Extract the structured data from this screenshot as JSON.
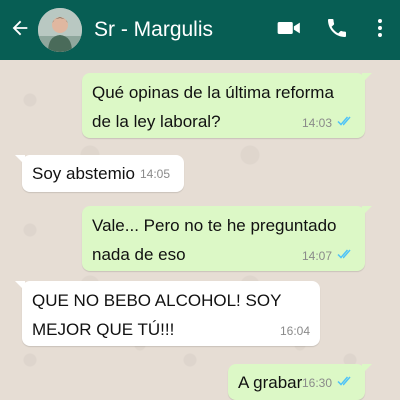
{
  "header": {
    "contact_name": "Sr - Margulis",
    "back_icon": "arrow-left-icon",
    "video_icon": "video-camera-icon",
    "call_icon": "phone-icon",
    "menu_icon": "more-vertical-icon",
    "bg_color": "#075e54"
  },
  "messages": [
    {
      "direction": "out",
      "text": "Qué opinas de la última reforma de la ley laboral?",
      "time": "14:03",
      "status": "read"
    },
    {
      "direction": "in",
      "text": "Soy abstemio",
      "time": "14:05"
    },
    {
      "direction": "out",
      "text": "Vale... Pero no te he preguntado nada de eso",
      "time": "14:07",
      "status": "read"
    },
    {
      "direction": "in",
      "text": "QUE NO BEBO ALCOHOL! SOY MEJOR QUE TÚ!!!",
      "time": "16:04"
    },
    {
      "direction": "out",
      "text": "A grabar",
      "time": "16:30",
      "status": "read"
    }
  ],
  "colors": {
    "outgoing_bubble": "#dcf8c6",
    "incoming_bubble": "#ffffff",
    "read_ticks": "#4fc3f7",
    "chat_bg": "#e6ddd4"
  }
}
